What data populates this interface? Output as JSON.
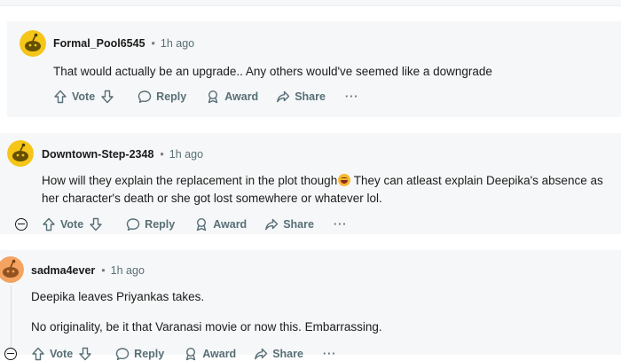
{
  "comments": [
    {
      "username": "Formal_Pool6545",
      "separator": "•",
      "time": "1h ago",
      "text_lines": [
        "That would actually be an upgrade.. Any others would've seemed like a downgrade"
      ],
      "avatar_color": "#f5c518",
      "actions": {
        "vote": "Vote",
        "reply": "Reply",
        "award": "Award",
        "share": "Share",
        "more": "···"
      }
    },
    {
      "username": "Downtown-Step-2348",
      "separator": "•",
      "time": "1h ago",
      "text_lines": [
        "How will they explain the replacement in the plot though",
        "They can atleast explain Deepika's absence as",
        "her character's death or she got lost somewhere or whatever lol."
      ],
      "avatar_color": "#f5c518",
      "actions": {
        "vote": "Vote",
        "reply": "Reply",
        "award": "Award",
        "share": "Share",
        "more": "···"
      }
    },
    {
      "username": "sadma4ever",
      "separator": "•",
      "time": "1h ago",
      "text_lines": [
        "Deepika leaves Priyankas takes.",
        "No originality, be it that Varanasi movie or now this. Embarrassing."
      ],
      "avatar_color": "#f4a360",
      "actions": {
        "vote": "Vote",
        "reply": "Reply",
        "award": "Award",
        "share": "Share",
        "more": "···"
      }
    }
  ]
}
